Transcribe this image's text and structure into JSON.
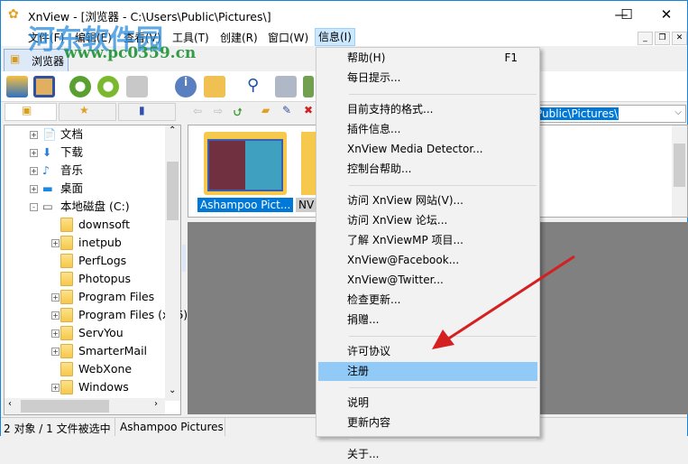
{
  "window": {
    "title": "XnView - [浏览器 - C:\\Users\\Public\\Pictures\\]",
    "minimize": "—",
    "maximize": "☐",
    "close": "✕"
  },
  "menubar": [
    "文件(F)",
    "编辑(E)",
    "查看(V)",
    "工具(T)",
    "创建(R)",
    "窗口(W)",
    "信息(I)"
  ],
  "watermark": {
    "name": "河东软件园",
    "url": "www.pc0359.cn"
  },
  "tab": {
    "label": "浏览器"
  },
  "path": {
    "value": "Public\\Pictures\\"
  },
  "tree": [
    {
      "label": "文档",
      "level": 1,
      "exp": "+",
      "icon": "document"
    },
    {
      "label": "下载",
      "level": 1,
      "exp": "+",
      "icon": "download"
    },
    {
      "label": "音乐",
      "level": 1,
      "exp": "+",
      "icon": "music"
    },
    {
      "label": "桌面",
      "level": 1,
      "exp": "+",
      "icon": "desktop"
    },
    {
      "label": "本地磁盘 (C:)",
      "level": 1,
      "exp": "-",
      "icon": "drive"
    },
    {
      "label": "downsoft",
      "level": 2,
      "exp": "",
      "icon": "folder"
    },
    {
      "label": "inetpub",
      "level": 2,
      "exp": "+",
      "icon": "folder"
    },
    {
      "label": "PerfLogs",
      "level": 2,
      "exp": "",
      "icon": "folder"
    },
    {
      "label": "Photopus",
      "level": 2,
      "exp": "",
      "icon": "folder"
    },
    {
      "label": "Program Files",
      "level": 2,
      "exp": "+",
      "icon": "folder"
    },
    {
      "label": "Program Files (x86)",
      "level": 2,
      "exp": "+",
      "icon": "folder"
    },
    {
      "label": "ServYou",
      "level": 2,
      "exp": "+",
      "icon": "folder"
    },
    {
      "label": "SmarterMail",
      "level": 2,
      "exp": "+",
      "icon": "folder"
    },
    {
      "label": "WebXone",
      "level": 2,
      "exp": "",
      "icon": "folder"
    },
    {
      "label": "Windows",
      "level": 2,
      "exp": "+",
      "icon": "folder"
    }
  ],
  "thumbnails": [
    {
      "label": "Ashampoo Pict...",
      "selected": true
    },
    {
      "label": "NV",
      "selected": false
    }
  ],
  "status": {
    "count": "2 对象 / 1 文件被选中",
    "selected": "Ashampoo Pictures"
  },
  "menu": {
    "items": [
      {
        "label": "帮助(H)",
        "shortcut": "F1"
      },
      {
        "label": "每日提示..."
      },
      {
        "sep": true
      },
      {
        "label": "目前支持的格式..."
      },
      {
        "label": "插件信息..."
      },
      {
        "label": "XnView Media Detector..."
      },
      {
        "label": "控制台帮助..."
      },
      {
        "sep": true
      },
      {
        "label": "访问 XnView 网站(V)..."
      },
      {
        "label": "访问 XnView 论坛..."
      },
      {
        "label": "了解 XnViewMP 项目..."
      },
      {
        "label": "XnView@Facebook..."
      },
      {
        "label": "XnView@Twitter..."
      },
      {
        "label": "检查更新..."
      },
      {
        "label": "捐赠..."
      },
      {
        "sep": true
      },
      {
        "label": "许可协议"
      },
      {
        "label": "注册",
        "highlighted": true
      },
      {
        "sep": true
      },
      {
        "label": "说明"
      },
      {
        "label": "更新内容"
      },
      {
        "sep": true
      },
      {
        "label": "关于..."
      }
    ]
  },
  "colors": {
    "selection": "#0078d7",
    "menu_highlight": "#91c9f7",
    "arrow": "#d42020"
  }
}
